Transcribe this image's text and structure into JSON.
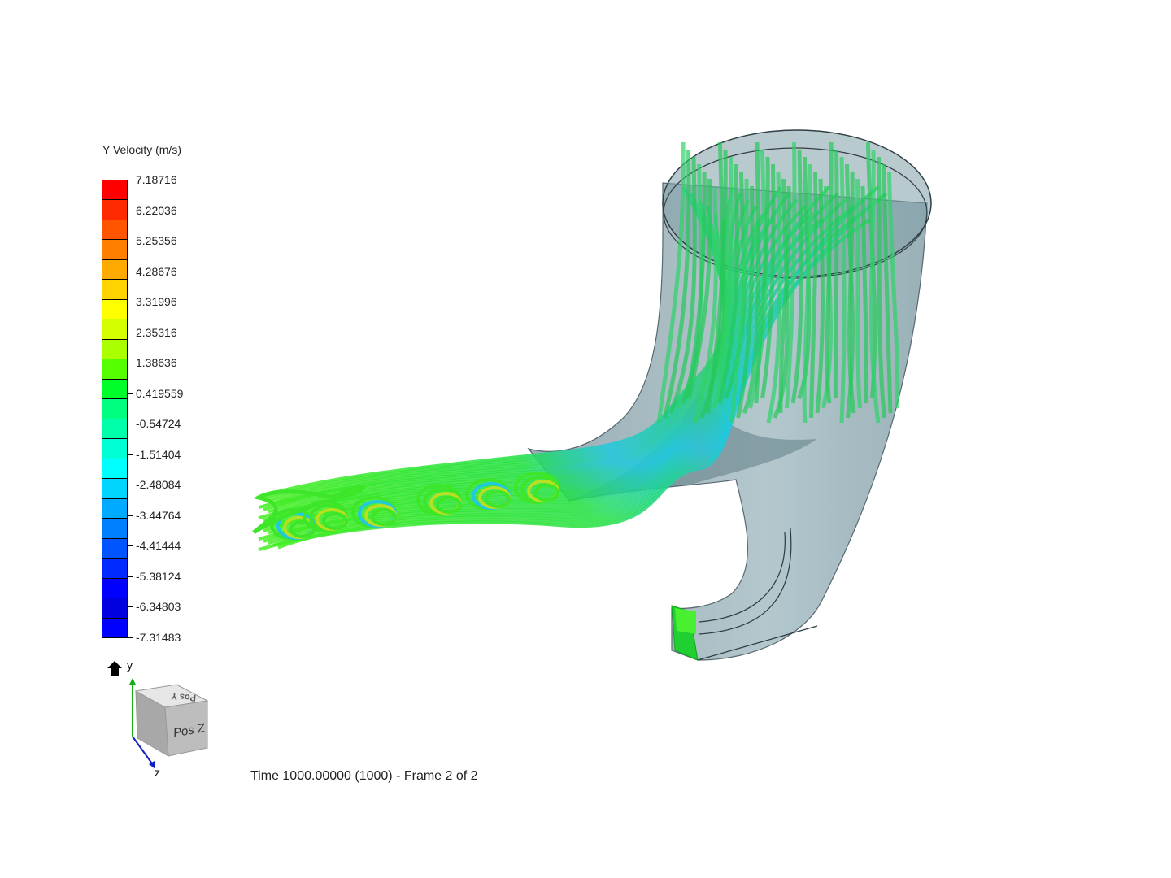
{
  "legend": {
    "title": "Y Velocity (m/s)",
    "ticks": [
      "7.18716",
      "6.22036",
      "5.25356",
      "4.28676",
      "3.31996",
      "2.35316",
      "1.38636",
      "0.419559",
      "-0.54724",
      "-1.51404",
      "-2.48084",
      "-3.44764",
      "-4.41444",
      "-5.38124",
      "-6.34803",
      "-7.31483"
    ],
    "colors": [
      "#ff0000",
      "#ff2a00",
      "#ff5500",
      "#ff7f00",
      "#ffaa00",
      "#ffd400",
      "#ffff00",
      "#d4ff00",
      "#aaff00",
      "#55ff00",
      "#00ff2a",
      "#00ff80",
      "#00ffaa",
      "#00ffd4",
      "#00ffff",
      "#00d4ff",
      "#00aaff",
      "#0080ff",
      "#0055ff",
      "#002aff",
      "#0000ff",
      "#0000e0",
      "#0000ff"
    ]
  },
  "orientation": {
    "y_label": "y",
    "z_label": "z",
    "face_front": "Pos Z",
    "face_top": "Pos Y",
    "home_icon": "home-icon"
  },
  "status": {
    "time_text": "Time 1000.00000 (1000) - Frame 2 of 2"
  },
  "colors": {
    "pipe_fill": "#6e8f99",
    "streamline_green": "#2ecc40",
    "streamline_cyan": "#14c8e6"
  }
}
